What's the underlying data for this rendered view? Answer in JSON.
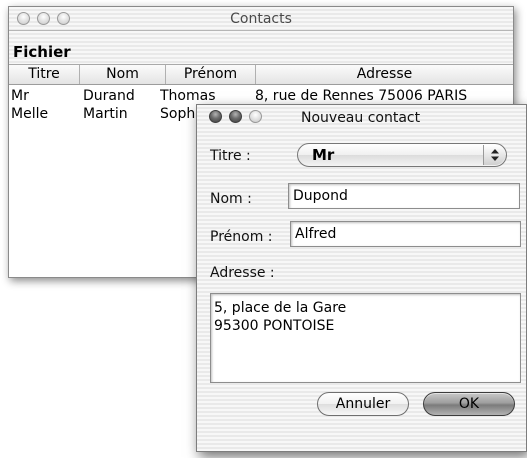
{
  "main_window": {
    "title": "Contacts",
    "menu": [
      "Fichier"
    ],
    "columns": [
      "Titre",
      "Nom",
      "Prénom",
      "Adresse"
    ],
    "rows": [
      [
        "Mr",
        "Durand",
        "Thomas",
        "8, rue de Rennes 75006 PARIS"
      ],
      [
        "Melle",
        "Martin",
        "Sophie",
        ""
      ]
    ]
  },
  "dialog": {
    "title": "Nouveau contact",
    "titre_label": "Titre :",
    "titre_value": "Mr",
    "nom_label": "Nom :",
    "nom_value": "Dupond",
    "prenom_label": "Prénom :",
    "prenom_value": "Alfred",
    "adresse_label": "Adresse :",
    "adresse_value": "5, place de la Gare\n95300 PONTOISE",
    "cancel_label": "Annuler",
    "ok_label": "OK"
  },
  "colors": {
    "window_border": "#8a8a8a",
    "default_button": "#9e9e9e"
  }
}
